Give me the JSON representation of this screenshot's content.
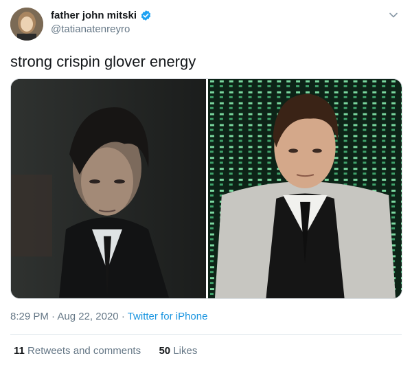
{
  "author": {
    "name": "father john mitski",
    "handle": "@tatianatenreyro",
    "verified_icon": "verified-badge-icon",
    "verified_color": "#1da1f2"
  },
  "tweet": {
    "text": "strong crispin glover energy"
  },
  "media": {
    "photos": [
      "portrait-dark-haired-man-dark-background",
      "portrait-man-gray-coat-green-code-background"
    ]
  },
  "meta": {
    "time": "8:29 PM",
    "separator": "·",
    "date": "Aug 22, 2020",
    "source": "Twitter for iPhone"
  },
  "stats": {
    "retweets_count": "11",
    "retweets_label": "Retweets and comments",
    "likes_count": "50",
    "likes_label": "Likes"
  },
  "colors": {
    "text": "#14171a",
    "secondary": "#657786",
    "link": "#1b95e0"
  }
}
